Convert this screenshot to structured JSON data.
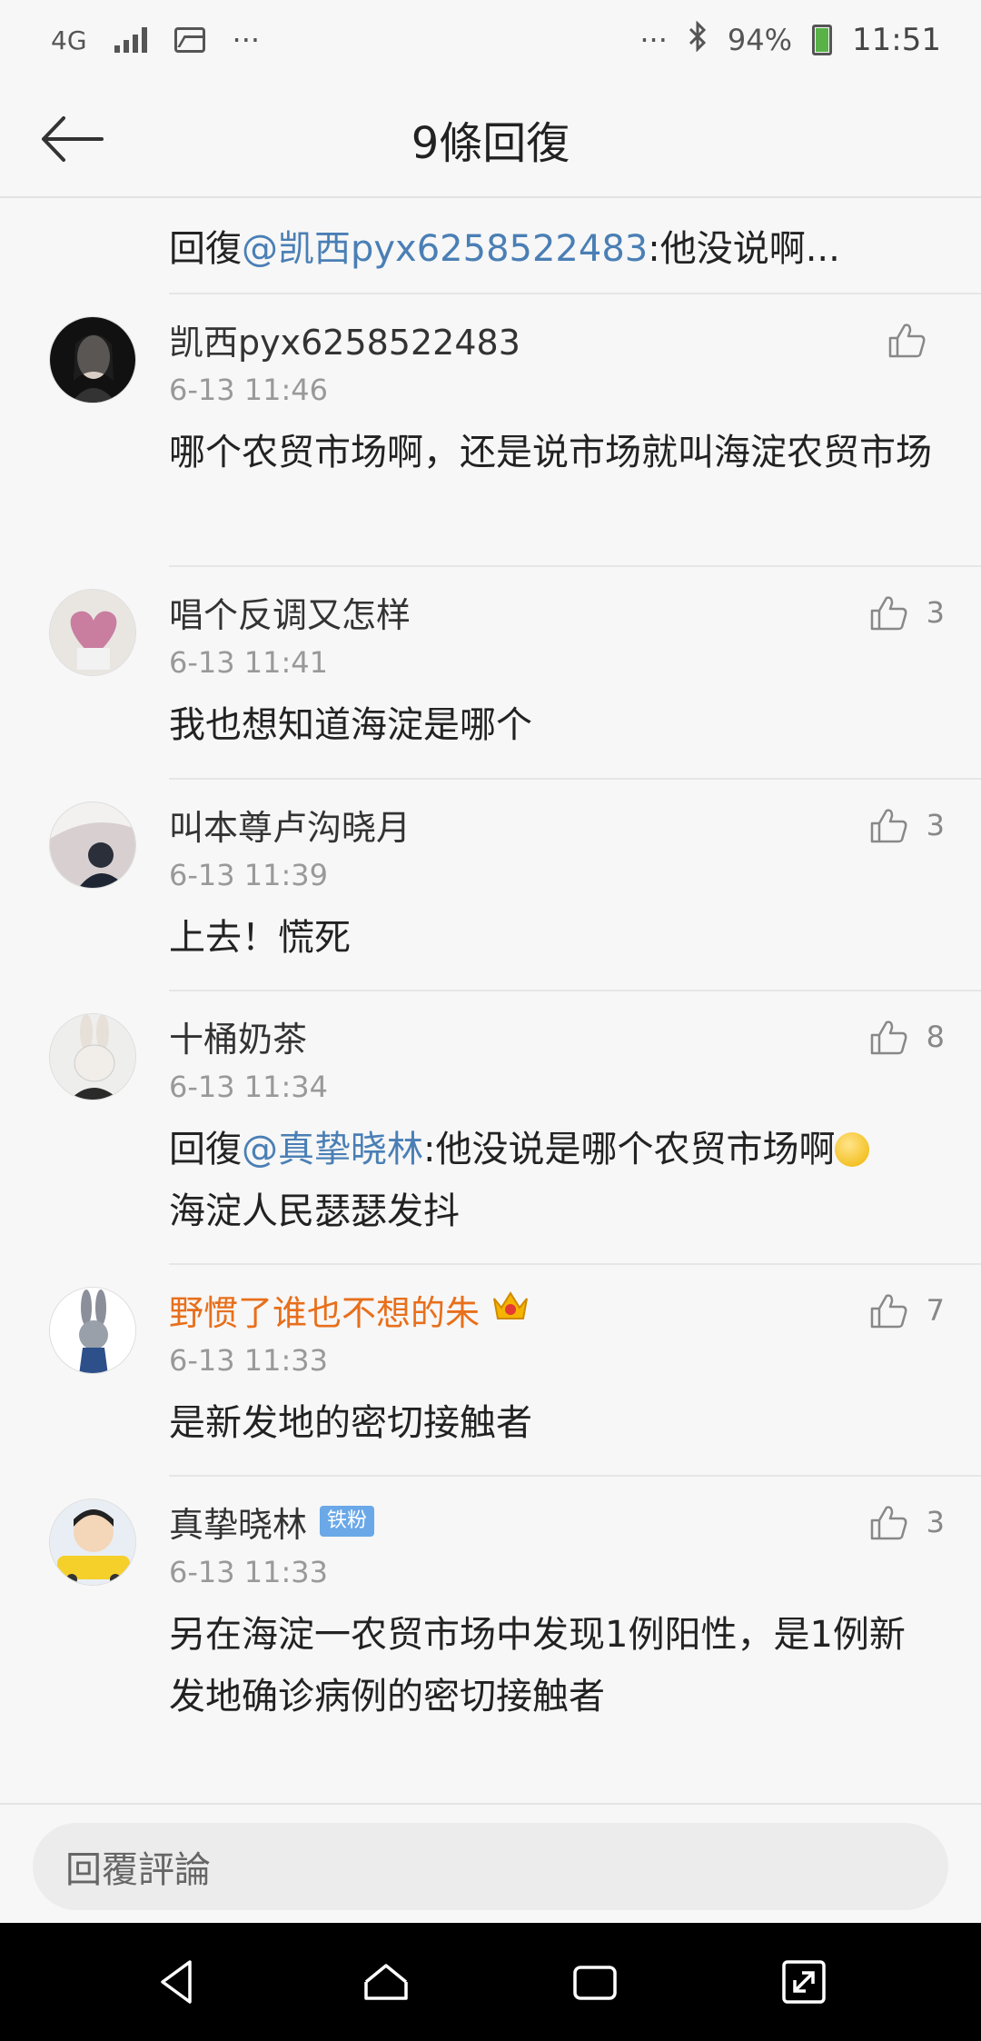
{
  "status_bar": {
    "network": "4G",
    "more_left": "···",
    "more_right": "···",
    "battery": "94%",
    "time": "11:51"
  },
  "header": {
    "title": "9條回復"
  },
  "origin": {
    "prefix": "回復",
    "mention": "@凯西pyx6258522483",
    "text": ":他没说啊..."
  },
  "comments": [
    {
      "name": "凯西pyx6258522483",
      "time": "6-13 11:46",
      "text": "哪个农贸市场啊，还是说市场就叫海淀农贸市场",
      "likes": ""
    },
    {
      "name": "唱个反调又怎样",
      "time": "6-13 11:41",
      "text": "我也想知道海淀是哪个",
      "likes": "3"
    },
    {
      "name": "叫本尊卢沟晓月",
      "time": "6-13 11:39",
      "text": "上去！慌死",
      "likes": "3"
    },
    {
      "name": "十桶奶茶",
      "time": "6-13 11:34",
      "reply_prefix": "回復",
      "mention": "@真挚晓林",
      "text": ":他没说是哪个农贸市场啊",
      "text2": "海淀人民瑟瑟发抖",
      "likes": "8"
    },
    {
      "name": "野惯了谁也不想的朱",
      "time": "6-13 11:33",
      "text": "是新发地的密切接触者",
      "likes": "7"
    },
    {
      "name": "真挚晓林",
      "badge": "铁粉",
      "time": "6-13 11:33",
      "text": "另在海淀一农贸市场中发现1例阳性，是1例新发地确诊病例的密切接触者",
      "likes": "3"
    }
  ],
  "reply_bar": {
    "placeholder": "回覆評論"
  },
  "colors": {
    "link": "#4a7fb5",
    "vip_name": "#e86f1b",
    "badge": "#6aa8e8"
  }
}
